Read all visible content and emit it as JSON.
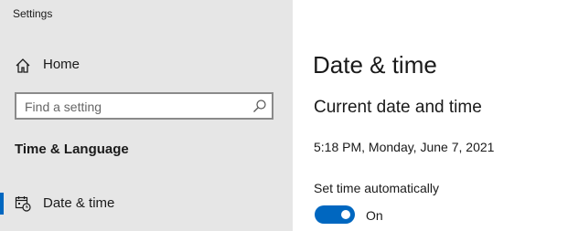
{
  "window": {
    "title": "Settings"
  },
  "sidebar": {
    "home": {
      "label": "Home",
      "icon": "home-icon"
    },
    "search": {
      "placeholder": "Find a setting",
      "icon": "search-icon"
    },
    "section_title": "Time & Language",
    "items": [
      {
        "label": "Date & time",
        "icon": "calendar-clock-icon",
        "selected": true
      }
    ]
  },
  "main": {
    "title": "Date & time",
    "subheading": "Current date and time",
    "current_datetime": "5:18 PM, Monday, June 7, 2021",
    "set_time_auto": {
      "label": "Set time automatically",
      "state_label": "On",
      "on": true
    }
  },
  "colors": {
    "accent": "#0067c0",
    "sidebar_bg": "#e6e6e6",
    "main_bg": "#ffffff"
  }
}
